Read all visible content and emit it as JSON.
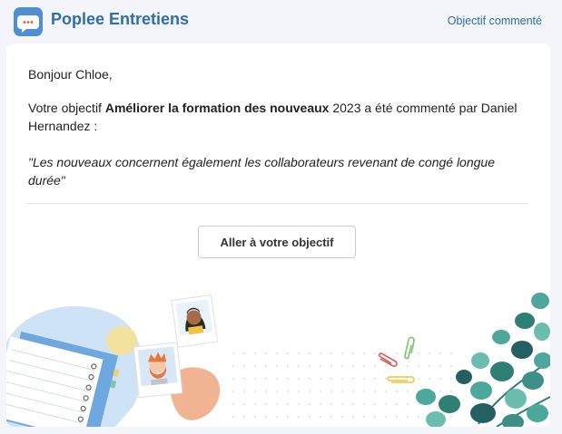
{
  "header": {
    "app_name": "Poplee Entretiens",
    "link_label": "Objectif commenté",
    "logo_icon": "chat-bubble-icon",
    "brand_color": "#2f6ea8"
  },
  "email": {
    "greeting": "Bonjour Chloe,",
    "intro_before": "Votre objectif ",
    "objective_name": "Améliorer la formation des nouveaux",
    "intro_after": " 2023 a été commenté par Daniel Hernandez :",
    "comment": "\"Les nouveaux concernent également les collaborateurs revenant de congé longue durée\"",
    "cta_label": "Aller à votre objectif"
  }
}
